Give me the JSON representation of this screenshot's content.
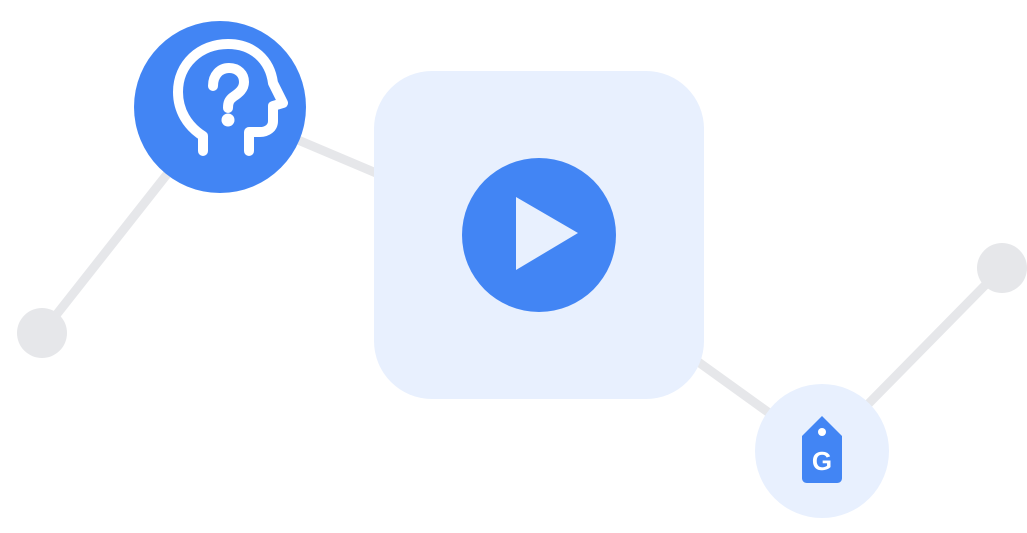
{
  "illustration": {
    "nodes": [
      {
        "id": "left-dot",
        "kind": "dot",
        "icon": ""
      },
      {
        "id": "help-node",
        "kind": "circle",
        "icon": "head-question-icon"
      },
      {
        "id": "video-tile",
        "kind": "rounded-square",
        "icon": "play-icon"
      },
      {
        "id": "tag-node",
        "kind": "circle",
        "icon": "g-tag-icon"
      },
      {
        "id": "right-dot",
        "kind": "dot",
        "icon": ""
      }
    ],
    "edges": [
      {
        "from": "left-dot",
        "to": "help-node"
      },
      {
        "from": "help-node",
        "to": "video-tile"
      },
      {
        "from": "video-tile",
        "to": "tag-node"
      },
      {
        "from": "tag-node",
        "to": "right-dot"
      }
    ],
    "tag_glyph": "G",
    "colors": {
      "primary_blue": "#4285F4",
      "light_blue": "#E8F0FE",
      "connector_gray": "#E6E7EA",
      "dot_gray": "#E6E7EA",
      "white": "#FFFFFF"
    }
  }
}
